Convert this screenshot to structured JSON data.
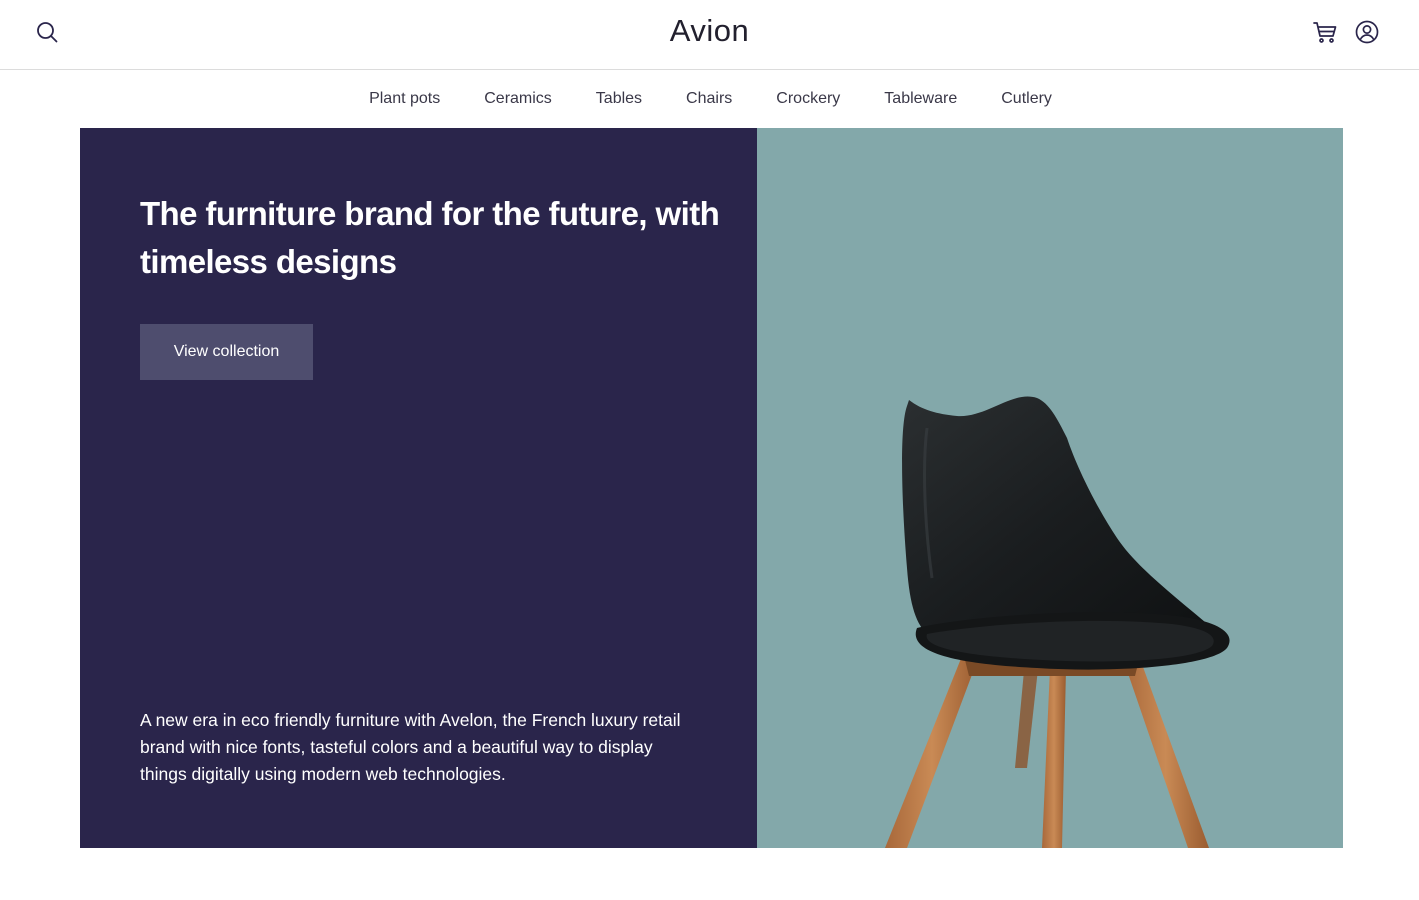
{
  "header": {
    "logo": "Avion",
    "search_icon": "search-icon",
    "cart_icon": "cart-icon",
    "user_icon": "user-icon"
  },
  "nav": {
    "items": [
      "Plant pots",
      "Ceramics",
      "Tables",
      "Chairs",
      "Crockery",
      "Tableware",
      "Cutlery"
    ]
  },
  "hero": {
    "title": "The furniture brand for the future, with timeless designs",
    "button_label": "View collection",
    "description": "A new era in eco friendly furniture with Avelon, the French luxury retail brand with nice fonts, tasteful colors and a beautiful way to display things digitally using modern web technologies.",
    "image": "black-chair-image"
  },
  "colors": {
    "hero_dark": "#2a254b",
    "hero_image_bg": "#83a8aa",
    "button_bg": "#4e4d6e",
    "text_dark": "#22202e"
  }
}
